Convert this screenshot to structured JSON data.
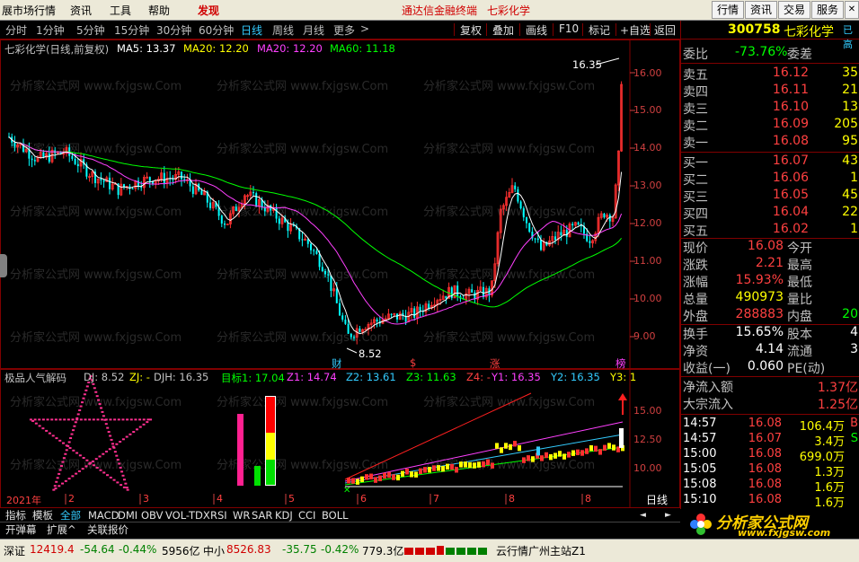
{
  "menu": {
    "items": [
      "展市场行情",
      "资讯",
      "工具",
      "帮助"
    ],
    "discover": "发现",
    "center_title": "通达信金融终端",
    "center_stock": "七彩化学",
    "right_buttons": [
      "行情",
      "资讯",
      "交易",
      "服务"
    ]
  },
  "toolbar": {
    "periods": [
      "分时",
      "1分钟",
      "5分钟",
      "15分钟",
      "30分钟",
      "60分钟",
      "日线",
      "周线",
      "月线",
      "更多"
    ],
    "active_period": "日线",
    "more_arrow": ">",
    "tools": [
      "复权",
      "叠加",
      "画线",
      "F10",
      "标记",
      "+自选",
      "返回"
    ]
  },
  "main_chart": {
    "title": "七彩化学(日线,前复权)",
    "ma": [
      {
        "label": "MA5: 13.37",
        "color": "#ffffff"
      },
      {
        "label": "MA20: 12.20",
        "color": "#ffff00"
      },
      {
        "label": "MA20: 12.20",
        "color": "#ff40ff"
      },
      {
        "label": "MA60: 11.18",
        "color": "#00ff00"
      }
    ],
    "y_ticks": [
      "16.00",
      "15.00",
      "14.00",
      "13.00",
      "12.00",
      "11.00",
      "10.00",
      "9.00"
    ],
    "high_label": "16.35",
    "low_label": "8.52",
    "markers": [
      "财",
      "$",
      "涨",
      "榜"
    ],
    "watermark": "分析家公式网 www.fxjgsw.Com"
  },
  "indicator": {
    "name": "极品人气解码",
    "fields": [
      {
        "label": "DJ: 8.52",
        "color": "#c0c0c0"
      },
      {
        "label": "ZJ: -",
        "color": "#ffff00"
      },
      {
        "label": "DJH: 16.35",
        "color": "#c0c0c0"
      },
      {
        "label": "目标1: 17.04",
        "color": "#00ff00"
      },
      {
        "label": "Z1: 14.74",
        "color": "#ff40ff"
      },
      {
        "label": "Z2: 13.61",
        "color": "#33ccff"
      },
      {
        "label": "Z3: 11.63",
        "color": "#00ff00"
      },
      {
        "label": "Z4: -",
        "color": "#ff4040"
      },
      {
        "label": "Y1: 16.35",
        "color": "#ff40ff"
      },
      {
        "label": "Y2: 16.35",
        "color": "#33ccff"
      },
      {
        "label": "Y3: 1",
        "color": "#ffff00"
      }
    ],
    "y_ticks": [
      "15.00",
      "12.50",
      "10.00"
    ],
    "x_labels": [
      "2021年",
      "2",
      "3",
      "4",
      "5",
      "6",
      "7",
      "8"
    ],
    "period_label": "日线"
  },
  "bottom_tabs": [
    "指标",
    "模板",
    "全部",
    "MACD",
    "DMI",
    "OBV",
    "VOL-TDX",
    "RSI",
    "WR",
    "SAR",
    "KDJ",
    "CCI",
    "BOLL"
  ],
  "bottom_tabs2": [
    "开弹幕",
    "扩展^",
    "关联报价"
  ],
  "quote": {
    "code": "300758",
    "name": "七彩化学",
    "tag": "已高",
    "weibi_label": "委比",
    "weibi": "-73.76%",
    "weicha_label": "委差",
    "asks": [
      {
        "label": "卖五",
        "price": "16.12",
        "vol": "35"
      },
      {
        "label": "卖四",
        "price": "16.11",
        "vol": "21"
      },
      {
        "label": "卖三",
        "price": "16.10",
        "vol": "13"
      },
      {
        "label": "卖二",
        "price": "16.09",
        "vol": "205"
      },
      {
        "label": "卖一",
        "price": "16.08",
        "vol": "95"
      }
    ],
    "bids": [
      {
        "label": "买一",
        "price": "16.07",
        "vol": "43"
      },
      {
        "label": "买二",
        "price": "16.06",
        "vol": "1"
      },
      {
        "label": "买三",
        "price": "16.05",
        "vol": "45"
      },
      {
        "label": "买四",
        "price": "16.04",
        "vol": "22"
      },
      {
        "label": "买五",
        "price": "16.02",
        "vol": "1"
      }
    ],
    "stats": [
      {
        "l1": "现价",
        "v1": "16.08",
        "c1": "#ff4040",
        "l2": "今开",
        "v2": ""
      },
      {
        "l1": "涨跌",
        "v1": "2.21",
        "c1": "#ff4040",
        "l2": "最高",
        "v2": ""
      },
      {
        "l1": "涨幅",
        "v1": "15.93%",
        "c1": "#ff4040",
        "l2": "最低",
        "v2": ""
      },
      {
        "l1": "总量",
        "v1": "490973",
        "c1": "#ffff00",
        "l2": "量比",
        "v2": ""
      },
      {
        "l1": "外盘",
        "v1": "288883",
        "c1": "#ff4040",
        "l2": "内盘",
        "v2": "20"
      }
    ],
    "stats2": [
      {
        "l1": "换手",
        "v1": "15.65%",
        "c1": "#ffffff",
        "l2": "股本",
        "v2": "4"
      },
      {
        "l1": "净资",
        "v1": "4.14",
        "c1": "#ffffff",
        "l2": "流通",
        "v2": "3"
      },
      {
        "l1": "收益(一)",
        "v1": "0.060",
        "c1": "#ffffff",
        "l2": "PE(动)",
        "v2": ""
      }
    ],
    "flows": [
      {
        "label": "净流入额",
        "value": "1.37亿"
      },
      {
        "label": "大宗流入",
        "value": "1.25亿"
      }
    ],
    "ticks": [
      {
        "time": "14:57",
        "price": "16.08",
        "vol": "106.4万",
        "dir": "B"
      },
      {
        "time": "14:57",
        "price": "16.07",
        "vol": "3.4万",
        "dir": "S"
      },
      {
        "time": "15:00",
        "price": "16.08",
        "vol": "699.0万",
        "dir": ""
      },
      {
        "time": "15:05",
        "price": "16.08",
        "vol": "1.3万",
        "dir": ""
      },
      {
        "time": "15:08",
        "price": "16.08",
        "vol": "1.6万",
        "dir": ""
      },
      {
        "time": "15:10",
        "price": "16.08",
        "vol": "1.6万",
        "dir": ""
      }
    ]
  },
  "status": {
    "sz_label": "深证",
    "sz_val": "12419.4",
    "sz_chg": "-54.64",
    "sz_pct": "-0.44%",
    "sz_amt": "5956亿",
    "zx_label": "中小",
    "zx_val": "8526.83",
    "zx_chg": "-35.75",
    "zx_pct": "-0.42%",
    "zx_amt": "779.3亿",
    "server": "云行情广州主站Z1"
  },
  "logo": {
    "name": "分析家公式网",
    "url": "www.fxjgsw.com"
  }
}
